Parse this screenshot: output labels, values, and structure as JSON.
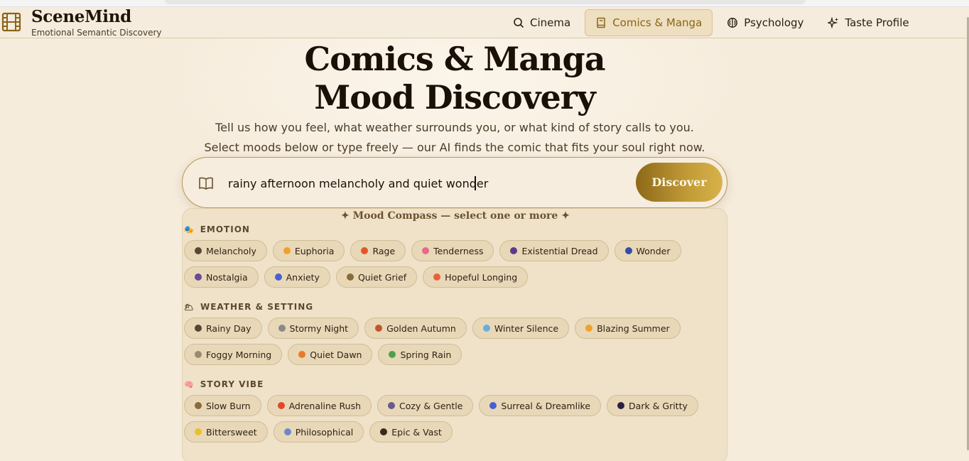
{
  "brand": {
    "title": "SceneMind",
    "subtitle": "Emotional Semantic Discovery"
  },
  "nav": [
    {
      "label": "Cinema",
      "icon": "search-icon",
      "active": false
    },
    {
      "label": "Comics & Manga",
      "icon": "book-icon",
      "active": true
    },
    {
      "label": "Psychology",
      "icon": "brain-icon",
      "active": false
    },
    {
      "label": "Taste Profile",
      "icon": "sparkles-icon",
      "active": false
    }
  ],
  "hero": {
    "title_line1": "Comics & Manga",
    "title_line2": "Mood Discovery",
    "sub_line1": "Tell us how you feel, what weather surrounds you, or what kind of story calls to you.",
    "sub_line2": "Select moods below or type freely — our AI finds the comic that fits your soul right now."
  },
  "search": {
    "value": "rainy afternoon melancholy and quiet wonder",
    "button_label": "Discover"
  },
  "compass": {
    "title": "✦ Mood Compass — select one or more ✦",
    "sections": [
      {
        "label": "EMOTION",
        "icon": "theater-masks-icon",
        "rows": [
          [
            {
              "label": "Melancholy",
              "icon": "rain-cloud-icon",
              "color": "#5a4632"
            },
            {
              "label": "Euphoria",
              "icon": "sparkle-icon",
              "color": "#f2a02c"
            },
            {
              "label": "Rage",
              "icon": "fire-icon",
              "color": "#e2562a"
            },
            {
              "label": "Tenderness",
              "icon": "flower-icon",
              "color": "#e66a8c"
            },
            {
              "label": "Existential Dread",
              "icon": "orb-icon",
              "color": "#5b3a8c"
            },
            {
              "label": "Wonder",
              "icon": "aurora-icon",
              "color": "#2f4fa8"
            }
          ],
          [
            {
              "label": "Nostalgia",
              "icon": "cassette-icon",
              "color": "#6a4a9a"
            },
            {
              "label": "Anxiety",
              "icon": "spiral-icon",
              "color": "#4a5fd0"
            },
            {
              "label": "Quiet Grief",
              "icon": "candle-icon",
              "color": "#8a6a3a"
            },
            {
              "label": "Hopeful Longing",
              "icon": "sunrise-icon",
              "color": "#e8603a"
            }
          ]
        ]
      },
      {
        "label": "WEATHER & SETTING",
        "icon": "cloud-sun-icon",
        "rows": [
          [
            {
              "label": "Rainy Day",
              "icon": "umbrella-icon",
              "color": "#5a4632"
            },
            {
              "label": "Stormy Night",
              "icon": "storm-icon",
              "color": "#8a8a8a"
            },
            {
              "label": "Golden Autumn",
              "icon": "leaf-icon",
              "color": "#c4552a"
            },
            {
              "label": "Winter Silence",
              "icon": "snowflake-icon",
              "color": "#6aaed8"
            },
            {
              "label": "Blazing Summer",
              "icon": "sun-icon",
              "color": "#f2a02c"
            }
          ],
          [
            {
              "label": "Foggy Morning",
              "icon": "fog-icon",
              "color": "#9a8a72"
            },
            {
              "label": "Quiet Dawn",
              "icon": "sunrise-mountain-icon",
              "color": "#e87a2a"
            },
            {
              "label": "Spring Rain",
              "icon": "sprout-icon",
              "color": "#4ea04a"
            }
          ]
        ]
      },
      {
        "label": "STORY VIBE",
        "icon": "brain-icon",
        "rows": [
          [
            {
              "label": "Slow Burn",
              "icon": "candle-icon",
              "color": "#8a6a3a"
            },
            {
              "label": "Adrenaline Rush",
              "icon": "lightning-icon",
              "color": "#e0482a"
            },
            {
              "label": "Cozy & Gentle",
              "icon": "orb-icon",
              "color": "#6a5a8a"
            },
            {
              "label": "Surreal & Dreamlike",
              "icon": "spiral-icon",
              "color": "#4a5fd0"
            },
            {
              "label": "Dark & Gritty",
              "icon": "heart-icon",
              "color": "#2a2040"
            }
          ],
          [
            {
              "label": "Bittersweet",
              "icon": "lemon-icon",
              "color": "#e8c02a"
            },
            {
              "label": "Philosophical",
              "icon": "book-icon",
              "color": "#6a8ac8"
            },
            {
              "label": "Epic & Vast",
              "icon": "mountain-icon",
              "color": "#3a2a1a"
            }
          ]
        ]
      }
    ]
  }
}
